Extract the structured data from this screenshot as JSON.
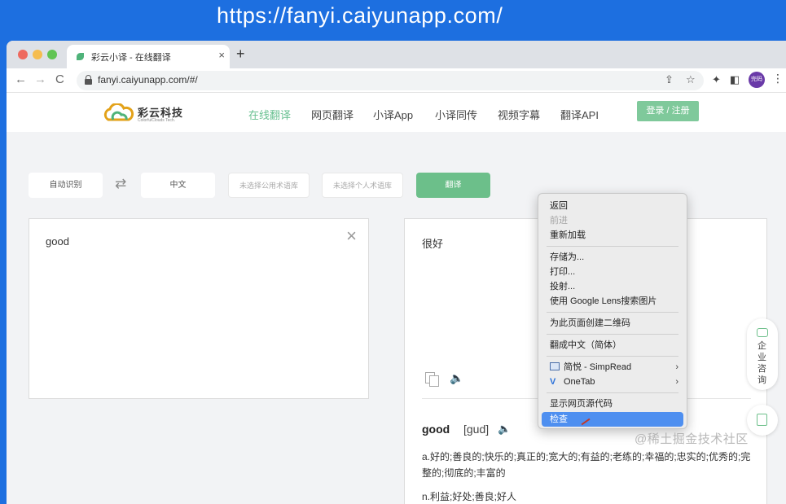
{
  "banner": {
    "url": "https://fanyi.caiyunapp.com/"
  },
  "browser": {
    "tab_title": "彩云小译 - 在线翻译",
    "tab_close": "×",
    "new_tab": "+",
    "back": "←",
    "forward": "→",
    "reload": "C",
    "address": "fanyi.caiyunapp.com/#/",
    "avatar_text": "完码"
  },
  "site": {
    "logo_text": "彩云科技",
    "logo_sub": "ColorfulClouds Tech.",
    "nav": [
      "在线翻译",
      "网页翻译",
      "小译App",
      "小译同传",
      "视频字幕",
      "翻译API"
    ],
    "login": "登录 / 注册"
  },
  "controls": {
    "source_lang": "自动识别",
    "target_lang": "中文",
    "public_glossary_placeholder": "未选择公用术语库",
    "personal_glossary_placeholder": "未选择个人术语库",
    "translate_button": "翻译"
  },
  "source": {
    "text": "good"
  },
  "output": {
    "text": "很好"
  },
  "dictionary": {
    "word": "good",
    "phonetic": "[gud]",
    "definition_adj": "a.好的;善良的;快乐的;真正的;宽大的;有益的;老练的;幸福的;忠实的;优秀的;完整的;彻底的;丰富的",
    "definition_noun": "n.利益;好处;善良;好人"
  },
  "side_widget": {
    "label": "企业咨询"
  },
  "context_menu": {
    "back": "返回",
    "forward": "前进",
    "reload": "重新加载",
    "save_as": "存储为...",
    "print": "打印...",
    "cast": "投射...",
    "google_lens": "使用 Google Lens搜索图片",
    "qr_code": "为此页面创建二维码",
    "translate": "翻成中文（简体）",
    "simpread": "简悦 - SimpRead",
    "onetab": "OneTab",
    "view_source": "显示网页源代码",
    "inspect": "检查"
  },
  "watermark": "@稀土掘金技术社区"
}
